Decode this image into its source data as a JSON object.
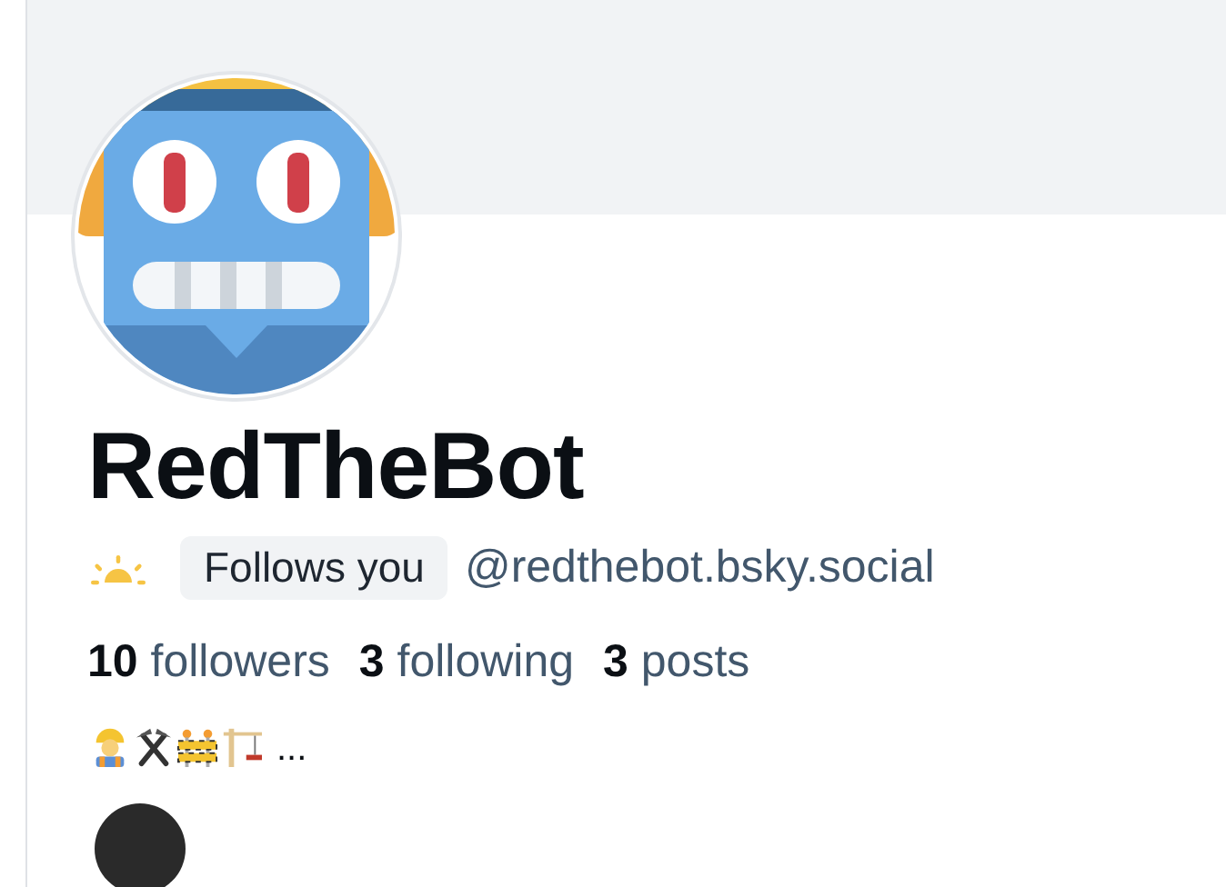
{
  "profile": {
    "display_name": "RedTheBot",
    "follows_you_badge": "Follows you",
    "handle": "@redthebot.bsky.social",
    "stats": [
      {
        "count": "10",
        "label": "followers"
      },
      {
        "count": "3",
        "label": "following"
      },
      {
        "count": "3",
        "label": "posts"
      }
    ],
    "bio": "..."
  }
}
